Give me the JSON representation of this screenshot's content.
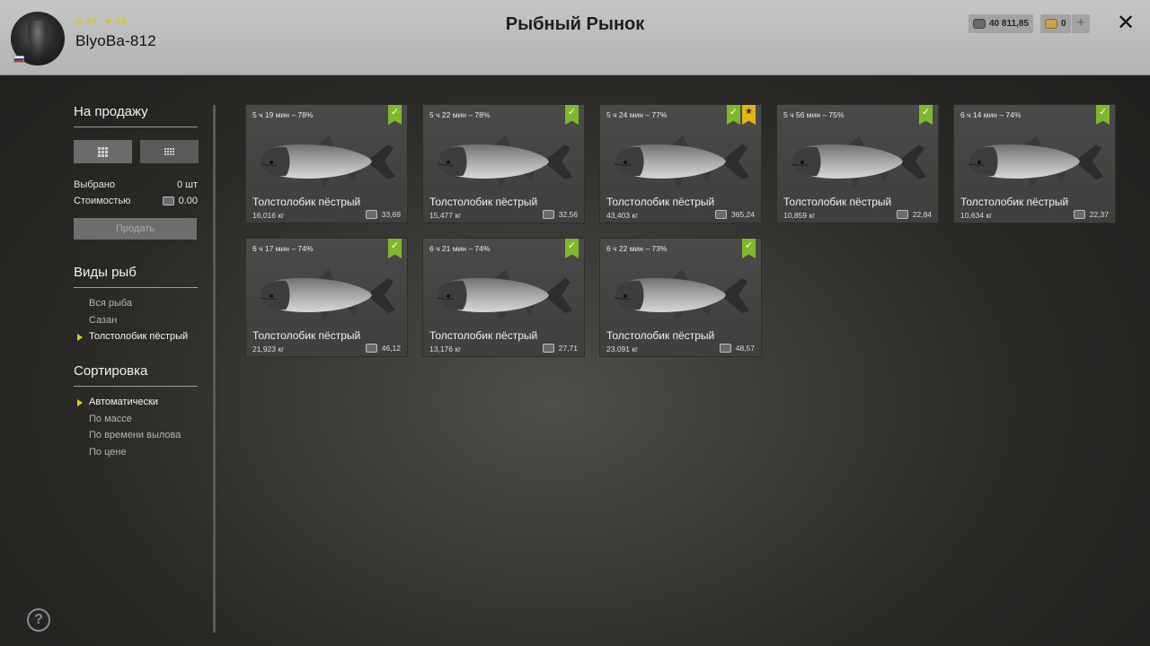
{
  "header": {
    "title": "Рыбный Рынок",
    "username": "BlyoBa-812",
    "stat1": "34",
    "stat2": "44",
    "silver": "40 811,85",
    "gold": "0",
    "plus": "+",
    "close": "✕"
  },
  "sidebar": {
    "for_sale": "На продажу",
    "selected_label": "Выбрано",
    "selected_value": "0 шт",
    "cost_label": "Стоимостью",
    "cost_value": "0.00",
    "sell_button": "Продать",
    "fish_types_title": "Виды рыб",
    "fish_types": [
      "Вся рыба",
      "Сазан",
      "Толстолобик пёстрый"
    ],
    "sort_title": "Сортировка",
    "sort_options": [
      "Автоматически",
      "По массе",
      "По времени вылова",
      "По цене"
    ],
    "help": "?"
  },
  "cards": [
    {
      "time": "5 ч 19 мин – 78%",
      "name": "Толстолобик пёстрый",
      "weight": "16,016 кг",
      "price": "33,69",
      "starred": false
    },
    {
      "time": "5 ч 22 мин – 78%",
      "name": "Толстолобик пёстрый",
      "weight": "15,477 кг",
      "price": "32,56",
      "starred": false
    },
    {
      "time": "5 ч 24 мин – 77%",
      "name": "Толстолобик пёстрый",
      "weight": "43,403 кг",
      "price": "365,24",
      "starred": true
    },
    {
      "time": "5 ч 56 мин – 75%",
      "name": "Толстолобик пёстрый",
      "weight": "10,859 кг",
      "price": "22,84",
      "starred": false
    },
    {
      "time": "6 ч 14 мин – 74%",
      "name": "Толстолобик пёстрый",
      "weight": "10,634 кг",
      "price": "22,37",
      "starred": false
    },
    {
      "time": "6 ч 17 мин – 74%",
      "name": "Толстолобик пёстрый",
      "weight": "21,923 кг",
      "price": "46,12",
      "starred": false
    },
    {
      "time": "6 ч 21 мин – 74%",
      "name": "Толстолобик пёстрый",
      "weight": "13,176 кг",
      "price": "27,71",
      "starred": false
    },
    {
      "time": "6 ч 22 мин – 73%",
      "name": "Толстолобик пёстрый",
      "weight": "23,091 кг",
      "price": "48,57",
      "starred": false
    }
  ],
  "colors": {
    "accent_yellow": "#e4d000",
    "check_green": "#7db82e",
    "star_gold": "#e3b414"
  }
}
